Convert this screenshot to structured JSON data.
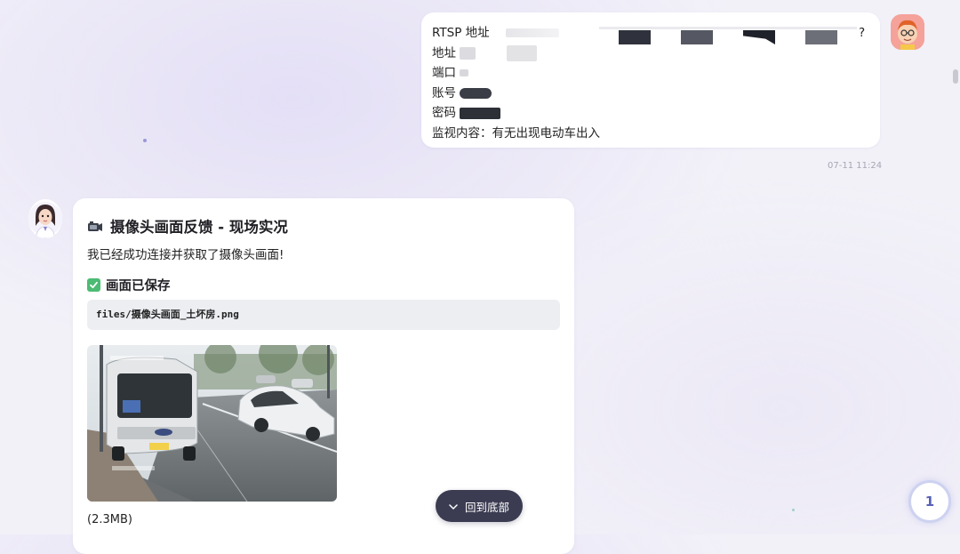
{
  "user_message": {
    "lines": [
      {
        "label": "RTSP 地址",
        "tail": "?"
      },
      {
        "label": "地址"
      },
      {
        "label": "端口"
      },
      {
        "label": "账号"
      },
      {
        "label": "密码"
      },
      {
        "label": "监视内容：有无出现电动车出入"
      }
    ],
    "timestamp": "07-11 11:24"
  },
  "bot_message": {
    "title": "摄像头画面反馈 - 现场实况",
    "intro": "我已经成功连接并获取了摄像头画面!",
    "saved_label": "画面已保存",
    "file_path": "files/摄像头画面_土坏房.png",
    "file_size": "(2.3MB)"
  },
  "controls": {
    "scroll_bottom_label": "回到底部",
    "badge_count": "1"
  },
  "icons": {
    "camera": "camera-icon",
    "check": "check-icon",
    "chevron": "chevron-down-icon"
  },
  "colors": {
    "accent_dark": "#3b3c52",
    "check_green": "#4cbb73",
    "badge_text": "#5861b5"
  }
}
